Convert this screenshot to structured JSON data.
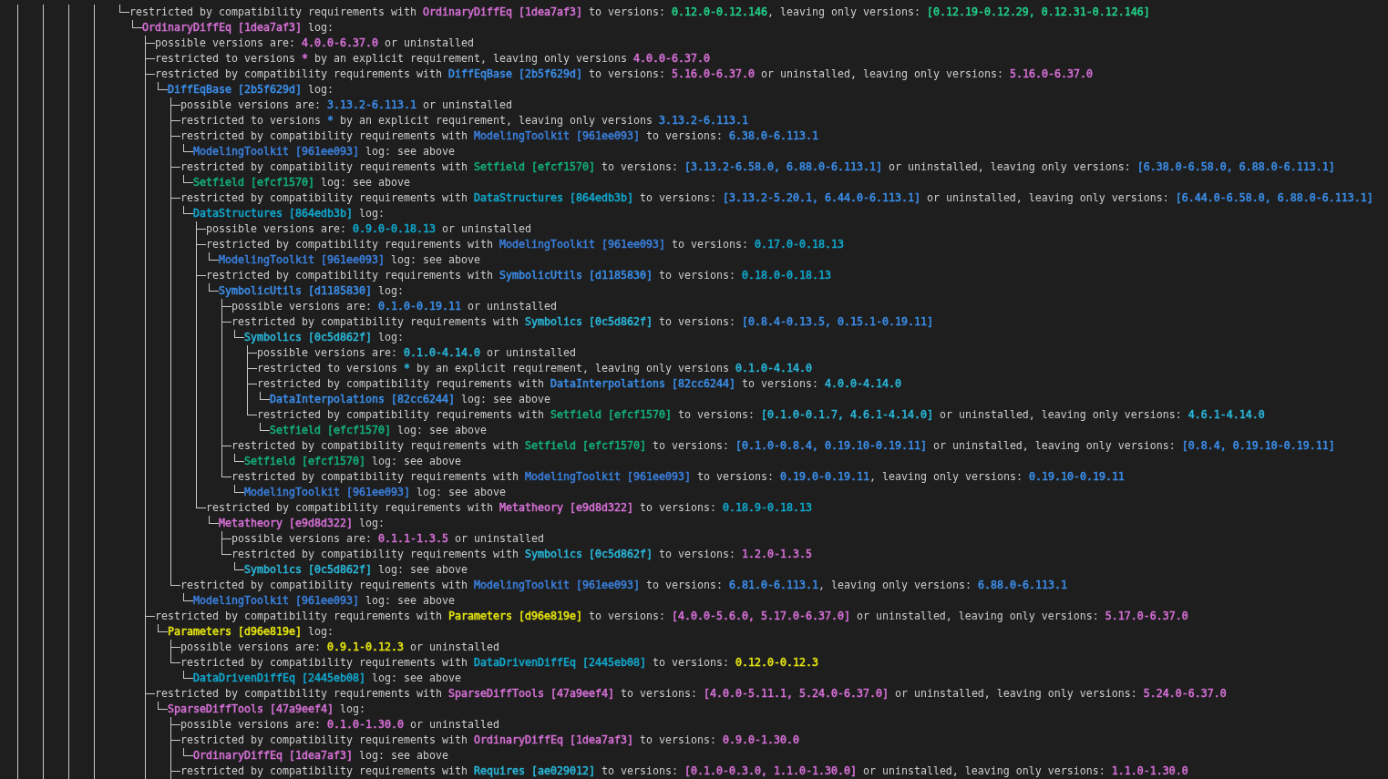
{
  "outer_guides": [
    false,
    true,
    false,
    true,
    false,
    true,
    false,
    true,
    false
  ],
  "log": [
    {
      "last": true,
      "parts": [
        {
          "text": "restricted by compatibility requirements with "
        },
        {
          "text": "OrdinaryDiffEq [1dea7af3]",
          "color": "#d670d6"
        },
        {
          "text": " to versions: "
        },
        {
          "text": "0.12.0-0.12.146",
          "color": "#23d18b"
        },
        {
          "text": ", leaving only versions: "
        },
        {
          "text": "[0.12.19-0.12.29, 0.12.31-0.12.146]",
          "color": "#23d18b"
        }
      ],
      "children": [
        {
          "last": true,
          "parts": [
            {
              "text": "OrdinaryDiffEq [1dea7af3]",
              "color": "#d670d6"
            },
            {
              "text": " log:"
            }
          ],
          "children": [
            {
              "last": false,
              "parts": [
                {
                  "text": "possible versions are: "
                },
                {
                  "text": "4.0.0-6.37.0",
                  "color": "#d670d6"
                },
                {
                  "text": " or uninstalled"
                }
              ]
            },
            {
              "last": false,
              "parts": [
                {
                  "text": "restricted to versions "
                },
                {
                  "text": "*",
                  "color": "#d670d6"
                },
                {
                  "text": " by an explicit requirement, leaving only versions "
                },
                {
                  "text": "4.0.0-6.37.0",
                  "color": "#d670d6"
                }
              ]
            },
            {
              "last": false,
              "parts": [
                {
                  "text": "restricted by compatibility requirements with "
                },
                {
                  "text": "DiffEqBase [2b5f629d]",
                  "color": "#3b8eea"
                },
                {
                  "text": " to versions: "
                },
                {
                  "text": "5.16.0-6.37.0",
                  "color": "#d670d6"
                },
                {
                  "text": " or uninstalled, leaving only versions: "
                },
                {
                  "text": "5.16.0-6.37.0",
                  "color": "#d670d6"
                }
              ],
              "children": [
                {
                  "last": true,
                  "parts": [
                    {
                      "text": "DiffEqBase [2b5f629d]",
                      "color": "#3b8eea"
                    },
                    {
                      "text": " log:"
                    }
                  ],
                  "children": [
                    {
                      "last": false,
                      "parts": [
                        {
                          "text": "possible versions are: "
                        },
                        {
                          "text": "3.13.2-6.113.1",
                          "color": "#3b8eea"
                        },
                        {
                          "text": " or uninstalled"
                        }
                      ]
                    },
                    {
                      "last": false,
                      "parts": [
                        {
                          "text": "restricted to versions "
                        },
                        {
                          "text": "*",
                          "color": "#3b8eea"
                        },
                        {
                          "text": " by an explicit requirement, leaving only versions "
                        },
                        {
                          "text": "3.13.2-6.113.1",
                          "color": "#3b8eea"
                        }
                      ]
                    },
                    {
                      "last": false,
                      "parts": [
                        {
                          "text": "restricted by compatibility requirements with "
                        },
                        {
                          "text": "ModelingToolkit [961ee093]",
                          "color": "#3a7fdc"
                        },
                        {
                          "text": " to versions: "
                        },
                        {
                          "text": "6.38.0-6.113.1",
                          "color": "#3b8eea"
                        }
                      ],
                      "children": [
                        {
                          "last": true,
                          "parts": [
                            {
                              "text": "ModelingToolkit [961ee093]",
                              "color": "#3a7fdc"
                            },
                            {
                              "text": " log: see above"
                            }
                          ]
                        }
                      ]
                    },
                    {
                      "last": false,
                      "parts": [
                        {
                          "text": "restricted by compatibility requirements with "
                        },
                        {
                          "text": "Setfield [efcf1570]",
                          "color": "#13b07a"
                        },
                        {
                          "text": " to versions: "
                        },
                        {
                          "text": "[3.13.2-6.58.0, 6.88.0-6.113.1]",
                          "color": "#3b8eea"
                        },
                        {
                          "text": " or uninstalled, leaving only versions: "
                        },
                        {
                          "text": "[6.38.0-6.58.0, 6.88.0-6.113.1]",
                          "color": "#3b8eea"
                        }
                      ],
                      "children": [
                        {
                          "last": true,
                          "parts": [
                            {
                              "text": "Setfield [efcf1570]",
                              "color": "#13b07a"
                            },
                            {
                              "text": " log: see above"
                            }
                          ]
                        }
                      ]
                    },
                    {
                      "last": false,
                      "parts": [
                        {
                          "text": "restricted by compatibility requirements with "
                        },
                        {
                          "text": "DataStructures [864edb3b]",
                          "color": "#11a8cd"
                        },
                        {
                          "text": " to versions: "
                        },
                        {
                          "text": "[3.13.2-5.20.1, 6.44.0-6.113.1]",
                          "color": "#3b8eea"
                        },
                        {
                          "text": " or uninstalled, leaving only versions: "
                        },
                        {
                          "text": "[6.44.0-6.58.0, 6.88.0-6.113.1]",
                          "color": "#3b8eea"
                        }
                      ],
                      "children": [
                        {
                          "last": true,
                          "parts": [
                            {
                              "text": "DataStructures [864edb3b]",
                              "color": "#11a8cd"
                            },
                            {
                              "text": " log:"
                            }
                          ],
                          "children": [
                            {
                              "last": false,
                              "parts": [
                                {
                                  "text": "possible versions are: "
                                },
                                {
                                  "text": "0.9.0-0.18.13",
                                  "color": "#11a8cd"
                                },
                                {
                                  "text": " or uninstalled"
                                }
                              ]
                            },
                            {
                              "last": false,
                              "parts": [
                                {
                                  "text": "restricted by compatibility requirements with "
                                },
                                {
                                  "text": "ModelingToolkit [961ee093]",
                                  "color": "#3a7fdc"
                                },
                                {
                                  "text": " to versions: "
                                },
                                {
                                  "text": "0.17.0-0.18.13",
                                  "color": "#11a8cd"
                                }
                              ],
                              "children": [
                                {
                                  "last": true,
                                  "parts": [
                                    {
                                      "text": "ModelingToolkit [961ee093]",
                                      "color": "#3a7fdc"
                                    },
                                    {
                                      "text": " log: see above"
                                    }
                                  ]
                                }
                              ]
                            },
                            {
                              "last": false,
                              "parts": [
                                {
                                  "text": "restricted by compatibility requirements with "
                                },
                                {
                                  "text": "SymbolicUtils [d1185830]",
                                  "color": "#3b8eea"
                                },
                                {
                                  "text": " to versions: "
                                },
                                {
                                  "text": "0.18.0-0.18.13",
                                  "color": "#11a8cd"
                                }
                              ],
                              "children": [
                                {
                                  "last": true,
                                  "parts": [
                                    {
                                      "text": "SymbolicUtils [d1185830]",
                                      "color": "#3b8eea"
                                    },
                                    {
                                      "text": " log:"
                                    }
                                  ],
                                  "children": [
                                    {
                                      "last": false,
                                      "parts": [
                                        {
                                          "text": "possible versions are: "
                                        },
                                        {
                                          "text": "0.1.0-0.19.11",
                                          "color": "#3b8eea"
                                        },
                                        {
                                          "text": " or uninstalled"
                                        }
                                      ]
                                    },
                                    {
                                      "last": false,
                                      "parts": [
                                        {
                                          "text": "restricted by compatibility requirements with "
                                        },
                                        {
                                          "text": "Symbolics [0c5d862f]",
                                          "color": "#29b8db"
                                        },
                                        {
                                          "text": " to versions: "
                                        },
                                        {
                                          "text": "[0.8.4-0.13.5, 0.15.1-0.19.11]",
                                          "color": "#3b8eea"
                                        }
                                      ],
                                      "children": [
                                        {
                                          "last": true,
                                          "parts": [
                                            {
                                              "text": "Symbolics [0c5d862f]",
                                              "color": "#29b8db"
                                            },
                                            {
                                              "text": " log:"
                                            }
                                          ],
                                          "children": [
                                            {
                                              "last": false,
                                              "parts": [
                                                {
                                                  "text": "possible versions are: "
                                                },
                                                {
                                                  "text": "0.1.0-4.14.0",
                                                  "color": "#29b8db"
                                                },
                                                {
                                                  "text": " or uninstalled"
                                                }
                                              ]
                                            },
                                            {
                                              "last": false,
                                              "parts": [
                                                {
                                                  "text": "restricted to versions "
                                                },
                                                {
                                                  "text": "*",
                                                  "color": "#29b8db"
                                                },
                                                {
                                                  "text": " by an explicit requirement, leaving only versions "
                                                },
                                                {
                                                  "text": "0.1.0-4.14.0",
                                                  "color": "#29b8db"
                                                }
                                              ]
                                            },
                                            {
                                              "last": false,
                                              "parts": [
                                                {
                                                  "text": "restricted by compatibility requirements with "
                                                },
                                                {
                                                  "text": "DataInterpolations [82cc6244]",
                                                  "color": "#3b8eea"
                                                },
                                                {
                                                  "text": " to versions: "
                                                },
                                                {
                                                  "text": "4.0.0-4.14.0",
                                                  "color": "#29b8db"
                                                }
                                              ],
                                              "children": [
                                                {
                                                  "last": true,
                                                  "parts": [
                                                    {
                                                      "text": "DataInterpolations [82cc6244]",
                                                      "color": "#3b8eea"
                                                    },
                                                    {
                                                      "text": " log: see above"
                                                    }
                                                  ]
                                                }
                                              ]
                                            },
                                            {
                                              "last": true,
                                              "parts": [
                                                {
                                                  "text": "restricted by compatibility requirements with "
                                                },
                                                {
                                                  "text": "Setfield [efcf1570]",
                                                  "color": "#13b07a"
                                                },
                                                {
                                                  "text": " to versions: "
                                                },
                                                {
                                                  "text": "[0.1.0-0.1.7, 4.6.1-4.14.0]",
                                                  "color": "#29b8db"
                                                },
                                                {
                                                  "text": " or uninstalled, leaving only versions: "
                                                },
                                                {
                                                  "text": "4.6.1-4.14.0",
                                                  "color": "#29b8db"
                                                }
                                              ],
                                              "children": [
                                                {
                                                  "last": true,
                                                  "parts": [
                                                    {
                                                      "text": "Setfield [efcf1570]",
                                                      "color": "#13b07a"
                                                    },
                                                    {
                                                      "text": " log: see above"
                                                    }
                                                  ]
                                                }
                                              ]
                                            }
                                          ]
                                        }
                                      ]
                                    },
                                    {
                                      "last": false,
                                      "parts": [
                                        {
                                          "text": "restricted by compatibility requirements with "
                                        },
                                        {
                                          "text": "Setfield [efcf1570]",
                                          "color": "#13b07a"
                                        },
                                        {
                                          "text": " to versions: "
                                        },
                                        {
                                          "text": "[0.1.0-0.8.4, 0.19.10-0.19.11]",
                                          "color": "#3b8eea"
                                        },
                                        {
                                          "text": " or uninstalled, leaving only versions: "
                                        },
                                        {
                                          "text": "[0.8.4, 0.19.10-0.19.11]",
                                          "color": "#3b8eea"
                                        }
                                      ],
                                      "children": [
                                        {
                                          "last": true,
                                          "parts": [
                                            {
                                              "text": "Setfield [efcf1570]",
                                              "color": "#13b07a"
                                            },
                                            {
                                              "text": " log: see above"
                                            }
                                          ]
                                        }
                                      ]
                                    },
                                    {
                                      "last": true,
                                      "parts": [
                                        {
                                          "text": "restricted by compatibility requirements with "
                                        },
                                        {
                                          "text": "ModelingToolkit [961ee093]",
                                          "color": "#3a7fdc"
                                        },
                                        {
                                          "text": " to versions: "
                                        },
                                        {
                                          "text": "0.19.0-0.19.11",
                                          "color": "#3b8eea"
                                        },
                                        {
                                          "text": ", leaving only versions: "
                                        },
                                        {
                                          "text": "0.19.10-0.19.11",
                                          "color": "#3b8eea"
                                        }
                                      ],
                                      "children": [
                                        {
                                          "last": true,
                                          "parts": [
                                            {
                                              "text": "ModelingToolkit [961ee093]",
                                              "color": "#3a7fdc"
                                            },
                                            {
                                              "text": " log: see above"
                                            }
                                          ]
                                        }
                                      ]
                                    }
                                  ]
                                }
                              ]
                            },
                            {
                              "last": true,
                              "parts": [
                                {
                                  "text": "restricted by compatibility requirements with "
                                },
                                {
                                  "text": "Metatheory [e9d8d322]",
                                  "color": "#d670d6"
                                },
                                {
                                  "text": " to versions: "
                                },
                                {
                                  "text": "0.18.9-0.18.13",
                                  "color": "#11a8cd"
                                }
                              ],
                              "children": [
                                {
                                  "last": true,
                                  "parts": [
                                    {
                                      "text": "Metatheory [e9d8d322]",
                                      "color": "#d670d6"
                                    },
                                    {
                                      "text": " log:"
                                    }
                                  ],
                                  "children": [
                                    {
                                      "last": false,
                                      "parts": [
                                        {
                                          "text": "possible versions are: "
                                        },
                                        {
                                          "text": "0.1.1-1.3.5",
                                          "color": "#d670d6"
                                        },
                                        {
                                          "text": " or uninstalled"
                                        }
                                      ]
                                    },
                                    {
                                      "last": true,
                                      "parts": [
                                        {
                                          "text": "restricted by compatibility requirements with "
                                        },
                                        {
                                          "text": "Symbolics [0c5d862f]",
                                          "color": "#29b8db"
                                        },
                                        {
                                          "text": " to versions: "
                                        },
                                        {
                                          "text": "1.2.0-1.3.5",
                                          "color": "#d670d6"
                                        }
                                      ],
                                      "children": [
                                        {
                                          "last": true,
                                          "parts": [
                                            {
                                              "text": "Symbolics [0c5d862f]",
                                              "color": "#29b8db"
                                            },
                                            {
                                              "text": " log: see above"
                                            }
                                          ]
                                        }
                                      ]
                                    }
                                  ]
                                }
                              ]
                            }
                          ]
                        }
                      ]
                    },
                    {
                      "last": true,
                      "parts": [
                        {
                          "text": "restricted by compatibility requirements with "
                        },
                        {
                          "text": "ModelingToolkit [961ee093]",
                          "color": "#3a7fdc"
                        },
                        {
                          "text": " to versions: "
                        },
                        {
                          "text": "6.81.0-6.113.1",
                          "color": "#3b8eea"
                        },
                        {
                          "text": ", leaving only versions: "
                        },
                        {
                          "text": "6.88.0-6.113.1",
                          "color": "#3b8eea"
                        }
                      ],
                      "children": [
                        {
                          "last": true,
                          "parts": [
                            {
                              "text": "ModelingToolkit [961ee093]",
                              "color": "#3a7fdc"
                            },
                            {
                              "text": " log: see above"
                            }
                          ]
                        }
                      ]
                    }
                  ]
                }
              ]
            },
            {
              "last": false,
              "parts": [
                {
                  "text": "restricted by compatibility requirements with "
                },
                {
                  "text": "Parameters [d96e819e]",
                  "color": "#e5e510"
                },
                {
                  "text": " to versions: "
                },
                {
                  "text": "[4.0.0-5.6.0, 5.17.0-6.37.0]",
                  "color": "#d670d6"
                },
                {
                  "text": " or uninstalled, leaving only versions: "
                },
                {
                  "text": "5.17.0-6.37.0",
                  "color": "#d670d6"
                }
              ],
              "children": [
                {
                  "last": true,
                  "parts": [
                    {
                      "text": "Parameters [d96e819e]",
                      "color": "#e5e510"
                    },
                    {
                      "text": " log:"
                    }
                  ],
                  "children": [
                    {
                      "last": false,
                      "parts": [
                        {
                          "text": "possible versions are: "
                        },
                        {
                          "text": "0.9.1-0.12.3",
                          "color": "#e5e510"
                        },
                        {
                          "text": " or uninstalled"
                        }
                      ]
                    },
                    {
                      "last": true,
                      "parts": [
                        {
                          "text": "restricted by compatibility requirements with "
                        },
                        {
                          "text": "DataDrivenDiffEq [2445eb08]",
                          "color": "#11a8cd"
                        },
                        {
                          "text": " to versions: "
                        },
                        {
                          "text": "0.12.0-0.12.3",
                          "color": "#e5e510"
                        }
                      ],
                      "children": [
                        {
                          "last": true,
                          "parts": [
                            {
                              "text": "DataDrivenDiffEq [2445eb08]",
                              "color": "#11a8cd"
                            },
                            {
                              "text": " log: see above"
                            }
                          ]
                        }
                      ]
                    }
                  ]
                }
              ]
            },
            {
              "last": false,
              "parts": [
                {
                  "text": "restricted by compatibility requirements with "
                },
                {
                  "text": "SparseDiffTools [47a9eef4]",
                  "color": "#d670d6"
                },
                {
                  "text": " to versions: "
                },
                {
                  "text": "[4.0.0-5.11.1, 5.24.0-6.37.0]",
                  "color": "#d670d6"
                },
                {
                  "text": " or uninstalled, leaving only versions: "
                },
                {
                  "text": "5.24.0-6.37.0",
                  "color": "#d670d6"
                }
              ],
              "children": [
                {
                  "last": true,
                  "parts": [
                    {
                      "text": "SparseDiffTools [47a9eef4]",
                      "color": "#d670d6"
                    },
                    {
                      "text": " log:"
                    }
                  ],
                  "children": [
                    {
                      "last": false,
                      "parts": [
                        {
                          "text": "possible versions are: "
                        },
                        {
                          "text": "0.1.0-1.30.0",
                          "color": "#d670d6"
                        },
                        {
                          "text": " or uninstalled"
                        }
                      ]
                    },
                    {
                      "last": false,
                      "parts": [
                        {
                          "text": "restricted by compatibility requirements with "
                        },
                        {
                          "text": "OrdinaryDiffEq [1dea7af3]",
                          "color": "#d670d6"
                        },
                        {
                          "text": " to versions: "
                        },
                        {
                          "text": "0.9.0-1.30.0",
                          "color": "#d670d6"
                        }
                      ],
                      "children": [
                        {
                          "last": true,
                          "parts": [
                            {
                              "text": "OrdinaryDiffEq [1dea7af3]",
                              "color": "#d670d6"
                            },
                            {
                              "text": " log: see above"
                            }
                          ]
                        }
                      ]
                    },
                    {
                      "last": false,
                      "parts": [
                        {
                          "text": "restricted by compatibility requirements with "
                        },
                        {
                          "text": "Requires [ae029012]",
                          "color": "#29b8db"
                        },
                        {
                          "text": " to versions: "
                        },
                        {
                          "text": "[0.1.0-0.3.0, 1.1.0-1.30.0]",
                          "color": "#d670d6"
                        },
                        {
                          "text": " or uninstalled, leaving only versions: "
                        },
                        {
                          "text": "1.1.0-1.30.0",
                          "color": "#d670d6"
                        }
                      ]
                    }
                  ]
                }
              ]
            }
          ]
        }
      ]
    }
  ]
}
